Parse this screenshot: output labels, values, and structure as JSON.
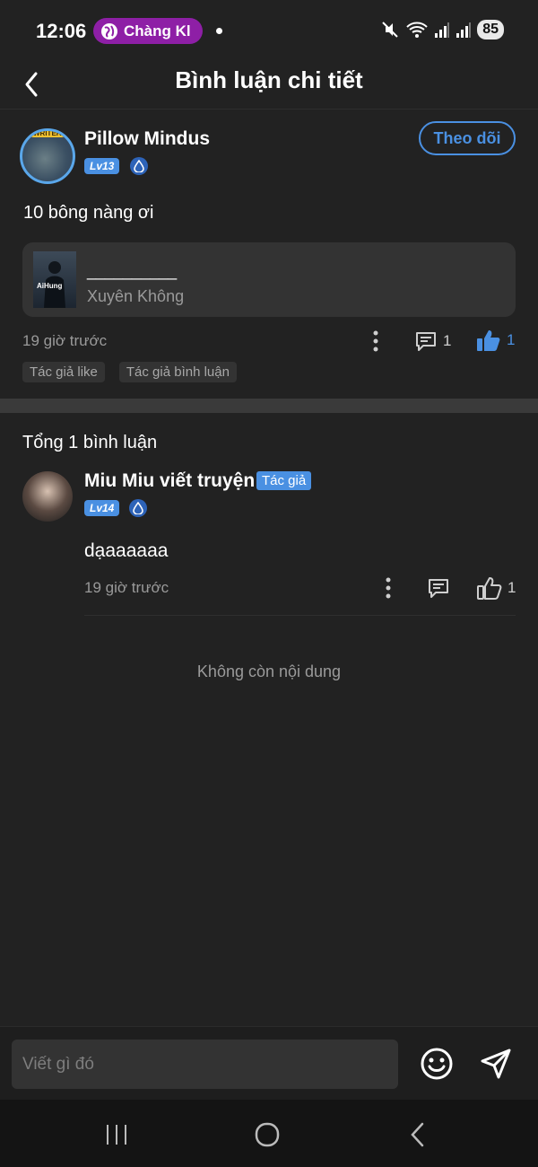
{
  "status": {
    "time": "12:06",
    "notification_pill": "Chàng Kl",
    "battery": "85"
  },
  "header": {
    "title": "Bình luận chi tiết"
  },
  "post": {
    "author_name": "Pillow Mindus",
    "avatar_badge": "WRITER",
    "level": "Lv13",
    "follow_label": "Theo dõi",
    "text": "10 bông nàng ơi",
    "book": {
      "cover_text": "AiHung",
      "title": "__________",
      "genre": "Xuyên Không"
    },
    "time": "19 giờ trước",
    "comment_count": "1",
    "like_count": "1",
    "tags": [
      "Tác giả like",
      "Tác giả bình luận"
    ]
  },
  "replies": {
    "total_label": "Tổng 1 bình luận",
    "items": [
      {
        "author_name": "Miu Miu viết truyện",
        "author_tag": "Tác giả",
        "level": "Lv14",
        "text": "dạaaaaaa",
        "time": "19 giờ trước",
        "like_count": "1"
      }
    ],
    "end_label": "Không còn nội dung"
  },
  "composer": {
    "placeholder": "Viết gì đó"
  },
  "colors": {
    "accent": "#4a90e2",
    "background": "#222222",
    "pill": "#8e1fa6"
  }
}
